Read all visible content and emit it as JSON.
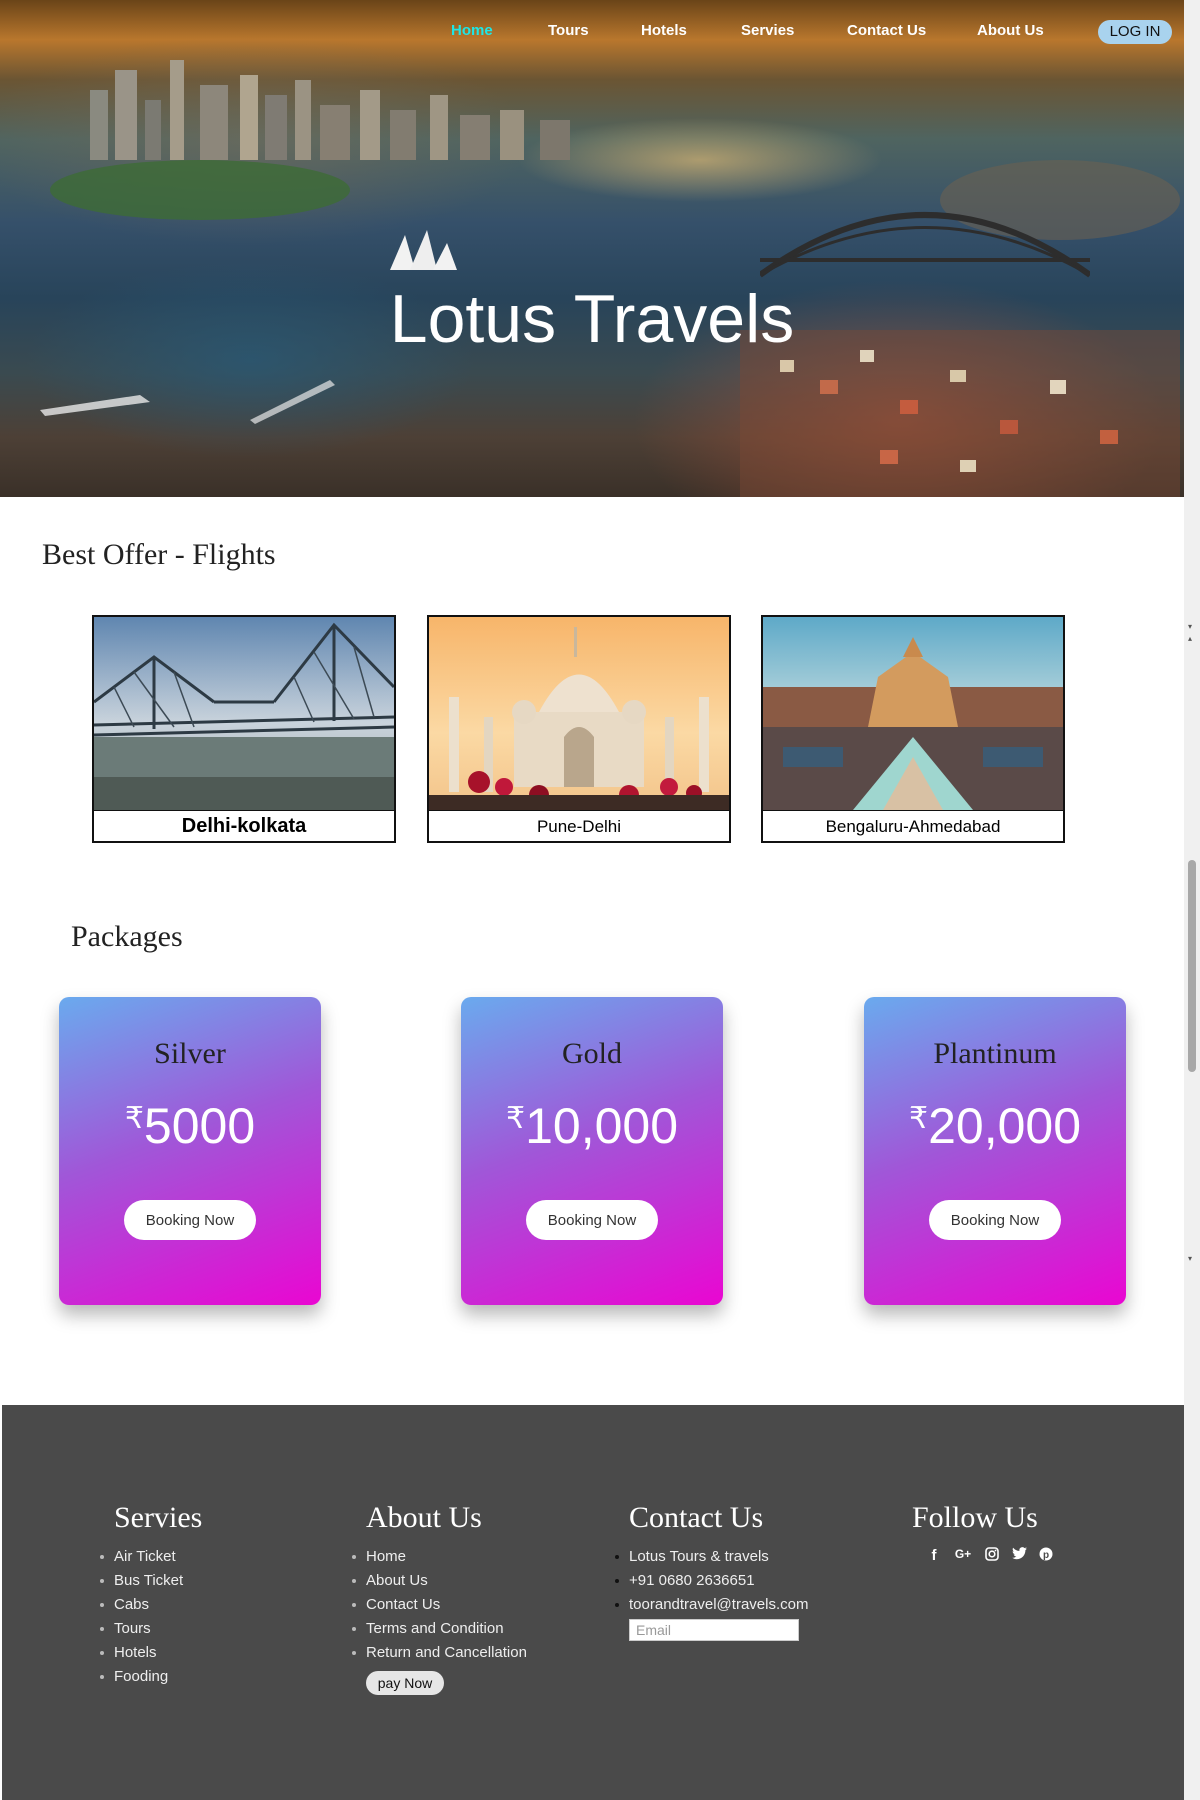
{
  "nav": {
    "items": [
      "Home",
      "Tours",
      "Hotels",
      "Servies",
      "Contact Us",
      "About Us"
    ],
    "login": "LOG IN"
  },
  "hero": {
    "title": "Lotus Travels"
  },
  "flights": {
    "title": "Best Offer - Flights",
    "cards": [
      {
        "route": "Delhi-kolkata"
      },
      {
        "route": "Pune-Delhi"
      },
      {
        "route": "Bengaluru-Ahmedabad"
      }
    ]
  },
  "packages": {
    "title": "Packages",
    "currency_symbol": "₹",
    "items": [
      {
        "name": "Silver",
        "price": "5000",
        "button": "Booking Now"
      },
      {
        "name": "Gold",
        "price": "10,000",
        "button": "Booking Now"
      },
      {
        "name": "Plantinum",
        "price": "20,000",
        "button": "Booking Now"
      }
    ]
  },
  "footer": {
    "services": {
      "title": "Servies",
      "items": [
        "Air Ticket",
        "Bus Ticket",
        "Cabs",
        "Tours",
        "Hotels",
        "Fooding"
      ]
    },
    "about": {
      "title": "About Us",
      "items": [
        "Home",
        "About Us",
        "Contact Us",
        "Terms and Condition",
        "Return and Cancellation"
      ],
      "pay_button": "pay Now"
    },
    "contact": {
      "title": "Contact Us",
      "items": [
        "Lotus Tours & travels",
        "+91 0680 2636651",
        "toorandtravel@travels.com"
      ],
      "email_placeholder": "Email"
    },
    "follow": {
      "title": "Follow Us",
      "icons": [
        "facebook-icon",
        "google-plus-icon",
        "instagram-icon",
        "twitter-icon",
        "pinterest-icon"
      ]
    }
  },
  "colors": {
    "nav_active": "#1ee6e6",
    "login_bg": "#a9d3ee",
    "footer_bg": "#4a4a4a",
    "package_gradient_start": "#6aaaee",
    "package_gradient_end": "#ea06d2"
  }
}
